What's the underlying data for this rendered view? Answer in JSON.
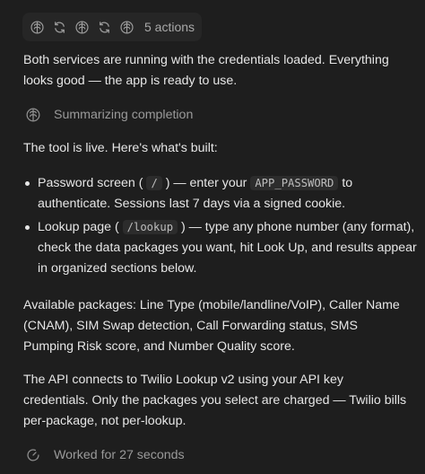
{
  "actions": {
    "label": "5 actions",
    "icons": [
      "brain-icon",
      "refresh-icon",
      "brain-icon",
      "refresh-icon",
      "brain-icon"
    ]
  },
  "messages": {
    "services_status": "Both services are running with the credentials loaded. Everything looks good — the app is ready to use.",
    "summarizing_label": "Summarizing completion",
    "intro": "The tool is live. Here's what's built:",
    "item1": {
      "prefix": "Password screen ( ",
      "code1": "/",
      "middle": " ) — enter your ",
      "code2": "APP_PASSWORD",
      "suffix": " to authenticate. Sessions last 7 days via a signed cookie."
    },
    "item2": {
      "prefix": "Lookup page ( ",
      "code1": "/lookup",
      "suffix": " ) — type any phone number (any format), check the data packages you want, hit Look Up, and results appear in organized sections below."
    },
    "packages": "Available packages: Line Type (mobile/landline/VoIP), Caller Name (CNAM), SIM Swap detection, Call Forwarding status, SMS Pumping Risk score, and Number Quality score.",
    "api_note": "The API connects to Twilio Lookup v2 using your API key credentials. Only the packages you select are charged — Twilio bills per-package, not per-lookup.",
    "worked_label": "Worked for 27 seconds"
  }
}
